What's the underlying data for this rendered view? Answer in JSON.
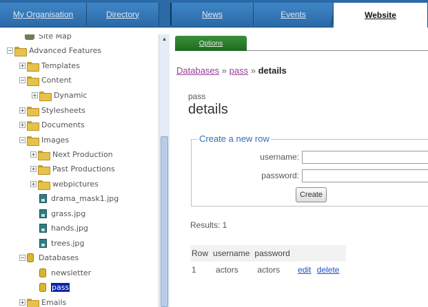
{
  "top_tabs": [
    {
      "label": "My Organisation",
      "active": false
    },
    {
      "label": "Directory",
      "active": false
    },
    {
      "label": "News",
      "active": false
    },
    {
      "label": "Events",
      "active": false
    },
    {
      "label": "Website",
      "active": true
    }
  ],
  "tree": {
    "items": [
      {
        "label": "Site Map",
        "icon": "sitemap-icon",
        "expander": ""
      },
      {
        "label": "Advanced Features",
        "icon": "folder-icon",
        "expander": "−"
      },
      {
        "label": "Templates",
        "icon": "folder-icon",
        "expander": "+"
      },
      {
        "label": "Content",
        "icon": "folder-icon",
        "expander": "−"
      },
      {
        "label": "Dynamic",
        "icon": "folder-icon",
        "expander": "+"
      },
      {
        "label": "Stylesheets",
        "icon": "folder-icon",
        "expander": "+"
      },
      {
        "label": "Documents",
        "icon": "folder-icon",
        "expander": "+"
      },
      {
        "label": "Images",
        "icon": "folder-icon",
        "expander": "−"
      },
      {
        "label": "Next Production",
        "icon": "folder-icon",
        "expander": "+"
      },
      {
        "label": "Past Productions",
        "icon": "folder-icon",
        "expander": "+"
      },
      {
        "label": "webpictures",
        "icon": "folder-icon",
        "expander": "+"
      },
      {
        "label": "drama_mask1.jpg",
        "icon": "image-file-icon",
        "expander": ""
      },
      {
        "label": "grass.jpg",
        "icon": "image-file-icon",
        "expander": ""
      },
      {
        "label": "hands.jpg",
        "icon": "image-file-icon",
        "expander": ""
      },
      {
        "label": "trees.jpg",
        "icon": "image-file-icon",
        "expander": ""
      },
      {
        "label": "Databases",
        "icon": "database-icon",
        "expander": "−"
      },
      {
        "label": "newsletter",
        "icon": "database-icon",
        "expander": ""
      },
      {
        "label": "pass",
        "icon": "database-icon",
        "expander": "",
        "selected": true
      },
      {
        "label": "Emails",
        "icon": "folder-icon",
        "expander": "+"
      }
    ]
  },
  "options_tab": {
    "label": "Options"
  },
  "breadcrumb": {
    "databases": "Databases",
    "sep1": "»",
    "pass": "pass",
    "sep2": "»",
    "current": "details"
  },
  "db_name": "pass",
  "heading": "details",
  "form": {
    "legend": "Create a new row",
    "username_label": "username:",
    "username_value": "",
    "password_label": "password:",
    "password_value": "",
    "create_label": "Create"
  },
  "results": {
    "text": "Results: 1"
  },
  "table": {
    "headers": [
      "Row",
      "username",
      "password"
    ],
    "rows": [
      {
        "row": "1",
        "username": "actors",
        "password": "actors",
        "edit": "edit",
        "delete": "delete"
      }
    ]
  },
  "colors": {
    "tab_bar": "#2a6aa6",
    "options_tab": "#2a7d2a",
    "link": "#1f4fc0",
    "breadcrumb_link": "#9a3d9a",
    "selected": "#0b24a8"
  }
}
